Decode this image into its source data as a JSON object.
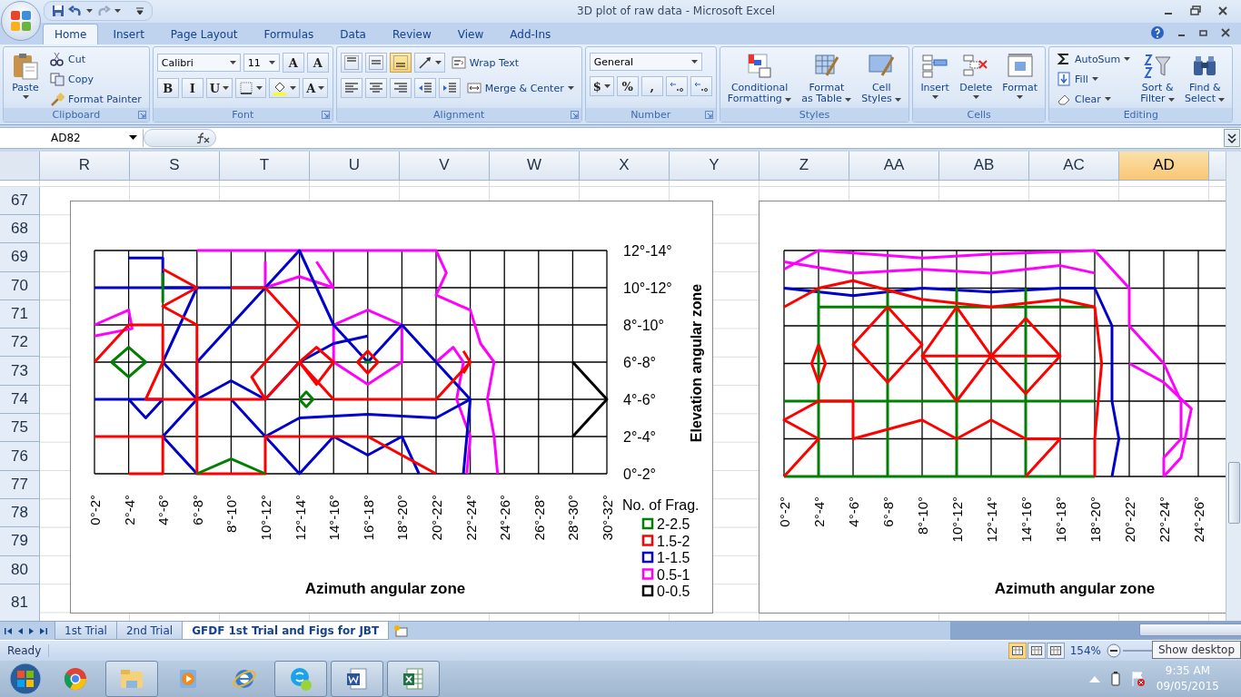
{
  "window": {
    "title": "3D plot of raw data - Microsoft Excel"
  },
  "ribbon_tabs": [
    {
      "label": "Home",
      "selected": true
    },
    {
      "label": "Insert",
      "selected": false
    },
    {
      "label": "Page Layout",
      "selected": false
    },
    {
      "label": "Formulas",
      "selected": false
    },
    {
      "label": "Data",
      "selected": false
    },
    {
      "label": "Review",
      "selected": false
    },
    {
      "label": "View",
      "selected": false
    },
    {
      "label": "Add-Ins",
      "selected": false
    }
  ],
  "ribbon_groups": [
    {
      "label": "Clipboard",
      "dialog_launcher": true,
      "columns": [
        [
          {
            "kind": "large",
            "lines": [
              "Paste"
            ],
            "dropdown": true
          }
        ],
        [
          {
            "kind": "small",
            "label": "Cut",
            "dropdown": false
          },
          {
            "kind": "small",
            "label": "Copy",
            "dropdown": false
          },
          {
            "kind": "small",
            "label": "Format Painter",
            "dropdown": false
          }
        ]
      ]
    },
    {
      "label": "Font",
      "dialog_launcher": true,
      "rows": [
        [
          {
            "kind": "field",
            "value": "Calibri",
            "dropdown": true
          },
          {
            "kind": "field",
            "value": "11",
            "dropdown": true
          },
          {
            "kind": "glyph",
            "label": "A",
            "dropdown": false
          },
          {
            "kind": "glyph",
            "label": "A",
            "dropdown": false
          }
        ],
        [
          {
            "kind": "glyph",
            "label": "B",
            "dropdown": false
          },
          {
            "kind": "glyph",
            "label": "I",
            "dropdown": false
          },
          {
            "kind": "glyph",
            "label": "U",
            "dropdown": true
          },
          {
            "kind": "tool",
            "dropdown": true
          },
          {
            "kind": "tool",
            "dropdown": true
          },
          {
            "kind": "glyph",
            "label": "A",
            "dropdown": true
          }
        ]
      ]
    },
    {
      "label": "Alignment",
      "dialog_launcher": true,
      "rows": [
        [
          {
            "kind": "toggle",
            "selected": false,
            "dropdown": false
          },
          {
            "kind": "toggle",
            "selected": false,
            "dropdown": false
          },
          {
            "kind": "toggle",
            "selected": true,
            "dropdown": false
          },
          {
            "kind": "tool",
            "dropdown": true
          },
          {
            "kind": "small",
            "label": "Wrap Text",
            "dropdown": false
          }
        ],
        [
          {
            "kind": "toggle",
            "selected": false,
            "dropdown": false
          },
          {
            "kind": "toggle",
            "selected": false,
            "dropdown": false
          },
          {
            "kind": "toggle",
            "selected": false,
            "dropdown": false
          },
          {
            "kind": "tool",
            "dropdown": false
          },
          {
            "kind": "tool",
            "dropdown": false
          },
          {
            "kind": "small",
            "label": "Merge & Center",
            "dropdown": true
          }
        ]
      ]
    },
    {
      "label": "Number",
      "dialog_launcher": true,
      "rows": [
        [
          {
            "kind": "field",
            "value": "General",
            "dropdown": true
          }
        ],
        [
          {
            "kind": "glyph",
            "label": "$",
            "dropdown": true
          },
          {
            "kind": "glyph",
            "label": "%",
            "dropdown": false
          },
          {
            "kind": "glyph",
            "label": ",",
            "dropdown": false
          },
          {
            "kind": "tool",
            "dropdown": false
          },
          {
            "kind": "tool",
            "dropdown": false
          }
        ]
      ]
    },
    {
      "label": "Styles",
      "dialog_launcher": false,
      "columns": [
        [
          {
            "kind": "large",
            "lines": [
              "Conditional",
              "Formatting"
            ],
            "dropdown": true
          }
        ],
        [
          {
            "kind": "large",
            "lines": [
              "Format",
              "as Table"
            ],
            "dropdown": true
          }
        ],
        [
          {
            "kind": "large",
            "lines": [
              "Cell",
              "Styles"
            ],
            "dropdown": true
          }
        ]
      ]
    },
    {
      "label": "Cells",
      "dialog_launcher": false,
      "columns": [
        [
          {
            "kind": "large",
            "lines": [
              "Insert"
            ],
            "dropdown": true
          }
        ],
        [
          {
            "kind": "large",
            "lines": [
              "Delete"
            ],
            "dropdown": true
          }
        ],
        [
          {
            "kind": "large",
            "lines": [
              "Format"
            ],
            "dropdown": true
          }
        ]
      ]
    },
    {
      "label": "Editing",
      "dialog_launcher": false,
      "columns": [
        [
          {
            "kind": "small",
            "label": "AutoSum",
            "dropdown": true
          },
          {
            "kind": "small",
            "label": "Fill",
            "dropdown": true
          },
          {
            "kind": "small",
            "label": "Clear",
            "dropdown": true
          }
        ],
        [
          {
            "kind": "large",
            "lines": [
              "Sort &",
              "Filter"
            ],
            "dropdown": true
          }
        ],
        [
          {
            "kind": "large",
            "lines": [
              "Find &",
              "Select"
            ],
            "dropdown": true
          }
        ]
      ]
    }
  ],
  "name_box": "AD82",
  "columns": [
    {
      "label": "R",
      "selected": false
    },
    {
      "label": "S",
      "selected": false
    },
    {
      "label": "T",
      "selected": false
    },
    {
      "label": "U",
      "selected": false
    },
    {
      "label": "V",
      "selected": false
    },
    {
      "label": "W",
      "selected": false
    },
    {
      "label": "X",
      "selected": false
    },
    {
      "label": "Y",
      "selected": false
    },
    {
      "label": "Z",
      "selected": false
    },
    {
      "label": "AA",
      "selected": false
    },
    {
      "label": "AB",
      "selected": false
    },
    {
      "label": "AC",
      "selected": false
    },
    {
      "label": "AD",
      "selected": true
    }
  ],
  "rows": [
    "67",
    "68",
    "69",
    "70",
    "71",
    "72",
    "73",
    "74",
    "75",
    "76",
    "77",
    "78",
    "79",
    "80",
    "81"
  ],
  "charts": [
    {
      "x_ticks": [
        "0°-2°",
        "2°-4°",
        "4°-6°",
        "6°-8°",
        "8°-10°",
        "10°-12°",
        "12°-14°",
        "14°-16°",
        "16°-18°",
        "18°-20°",
        "20°-22°",
        "22°-24°",
        "24°-26°",
        "26°-28°",
        "28°-30°",
        "30°-32°"
      ],
      "y_ticks": [
        "12°-14°",
        "10°-12°",
        "8°-10°",
        "6°-8°",
        "4°-6°",
        "2°-4°",
        "0°-2°"
      ],
      "x_title": "Azimuth angular zone",
      "y_title": "Elevation angular zone",
      "legend": {
        "title": "No. of Frag.",
        "entries": [
          {
            "label": "2-2.5",
            "color": "#008000"
          },
          {
            "label": "1.5-2",
            "color": "#ff0000"
          },
          {
            "label": "1-1.5",
            "color": "#0000cc"
          },
          {
            "label": "0.5-1",
            "color": "#ff00ff"
          },
          {
            "label": "0-0.5",
            "color": "#000000"
          }
        ]
      }
    },
    {
      "x_ticks": [
        "0°-2°",
        "2°-4°",
        "4°-6°",
        "6°-8°",
        "8°-10°",
        "10°-12°",
        "12°-14°",
        "14°-16°",
        "16°-18°",
        "18°-20°",
        "20°-22°",
        "22°-24°",
        "24°-26°"
      ],
      "x_title": "Azimuth angular zone"
    }
  ],
  "sheet_tabs": [
    {
      "label": "1st Trial",
      "selected": false
    },
    {
      "label": "2nd Trial",
      "selected": false
    },
    {
      "label": "GFDF 1st Trial and Figs for JBT",
      "selected": true
    }
  ],
  "status": {
    "text": "Ready",
    "views": [
      {
        "selected": true
      },
      {
        "selected": false
      },
      {
        "selected": false
      }
    ],
    "zoom": "154%"
  },
  "tooltip": "Show desktop",
  "taskbar": {
    "apps": [
      {
        "running": false
      },
      {
        "running": true
      },
      {
        "running": false
      },
      {
        "running": false
      },
      {
        "running": true
      },
      {
        "running": true
      },
      {
        "running": true
      }
    ],
    "time": "9:35 AM",
    "date": "09/05/2015"
  }
}
